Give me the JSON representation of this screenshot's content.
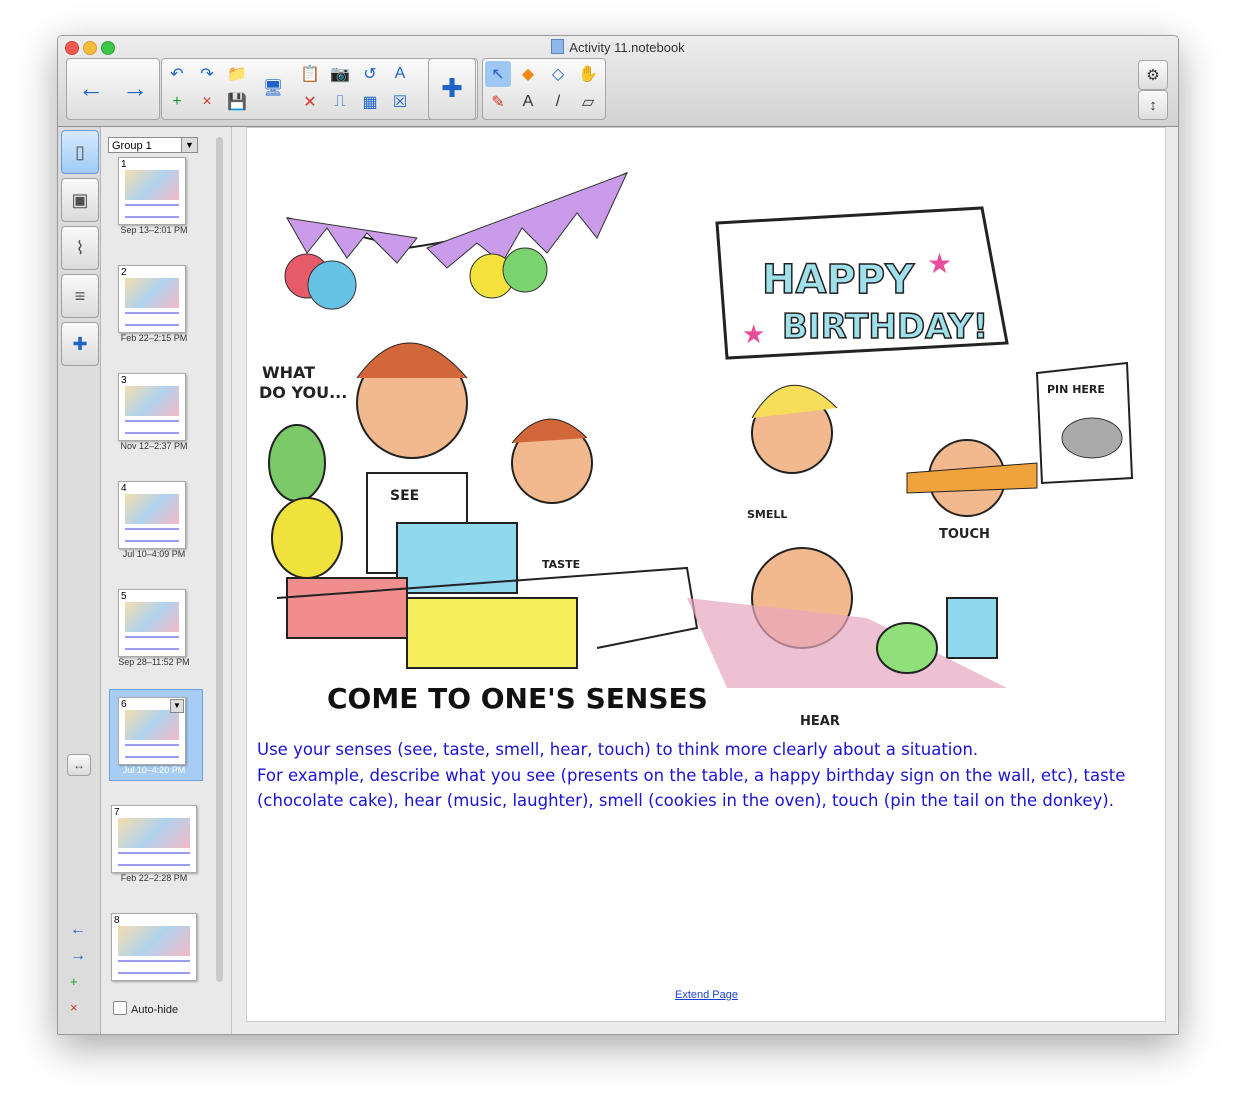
{
  "window": {
    "title": "Activity 11.notebook"
  },
  "toolbar": {
    "back_icon": "←",
    "forward_icon": "→",
    "icons": [
      "↶",
      "↷",
      "📁",
      "+",
      "×",
      "💾",
      "🖥",
      "📋",
      "📷",
      "↺",
      "A",
      "✕",
      "⎍",
      "▦",
      "☒",
      "✚",
      "↖",
      "◆",
      "◇",
      "✋",
      "✎",
      "A",
      "/",
      "▱"
    ],
    "settings_icon": "⚙",
    "resize_icon": "↕"
  },
  "sidebar": {
    "tabs": [
      "page-sorter",
      "gallery",
      "attachments",
      "properties",
      "addons"
    ],
    "group": "Group 1",
    "thumbs": [
      {
        "num": "1",
        "date": "Sep 13–2:01 PM"
      },
      {
        "num": "2",
        "date": "Feb 22–2:15 PM"
      },
      {
        "num": "3",
        "date": "Nov 12–2:37 PM"
      },
      {
        "num": "4",
        "date": "Jul 10–4:09 PM"
      },
      {
        "num": "5",
        "date": "Sep 28–11:52 PM"
      },
      {
        "num": "6",
        "date": "Jul 10–4:20 PM"
      },
      {
        "num": "7",
        "date": "Feb 22–2:28 PM"
      },
      {
        "num": "8",
        "date": ""
      }
    ],
    "autohide_label": "Auto-hide"
  },
  "page": {
    "image_caption": "COME TO ONE'S SENSES",
    "banner": "HAPPY BIRTHDAY!",
    "callout": "WHAT DO YOU...",
    "labels": [
      "SEE",
      "TASTE",
      "SMELL",
      "TOUCH",
      "HEAR",
      "PIN HERE"
    ],
    "text_line1": "Use your senses (see, taste, smell, hear, touch) to think more clearly about a situation.",
    "text_line2": "For example, describe what you see (presents on the table, a happy birthday sign on the wall, etc), taste (chocolate cake), hear (music, laughter), smell (cookies in the oven), touch (pin the tail on the donkey).",
    "extend_link": "Extend Page"
  }
}
